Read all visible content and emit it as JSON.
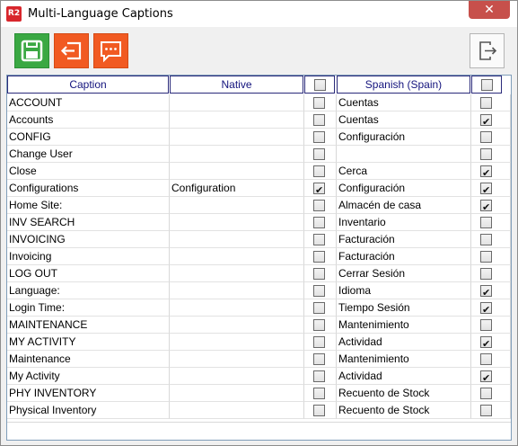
{
  "window": {
    "title": "Multi-Language Captions",
    "icon_text": "R2",
    "close_glyph": "✕"
  },
  "toolbar": {
    "buttons": [
      {
        "name": "save-button",
        "icon": "floppy-disk-icon",
        "color": "#3aa843"
      },
      {
        "name": "export-button",
        "icon": "export-icon",
        "color": "#f15a22"
      },
      {
        "name": "message-button",
        "icon": "chat-bubble-icon",
        "color": "#f15a22"
      },
      {
        "name": "exit-button",
        "icon": "exit-door-icon",
        "color": "#fafafa"
      }
    ]
  },
  "grid": {
    "headers": {
      "caption": "Caption",
      "native": "Native",
      "native_all_checked": false,
      "language": "Spanish (Spain)",
      "language_all_checked": false
    },
    "rows": [
      {
        "caption": "ACCOUNT",
        "native": "",
        "native_checked": false,
        "translation": "Cuentas",
        "translation_checked": false
      },
      {
        "caption": "Accounts",
        "native": "",
        "native_checked": false,
        "translation": "Cuentas",
        "translation_checked": true
      },
      {
        "caption": "CONFIG",
        "native": "",
        "native_checked": false,
        "translation": "Configuración",
        "translation_checked": false
      },
      {
        "caption": "Change User",
        "native": "",
        "native_checked": false,
        "translation": "",
        "translation_checked": false
      },
      {
        "caption": "Close",
        "native": "",
        "native_checked": false,
        "translation": "Cerca",
        "translation_checked": true
      },
      {
        "caption": "Configurations",
        "native": "Configuration",
        "native_checked": true,
        "translation": "Configuración",
        "translation_checked": true
      },
      {
        "caption": "Home Site:",
        "native": "",
        "native_checked": false,
        "translation": "Almacén de casa",
        "translation_checked": true
      },
      {
        "caption": "INV SEARCH",
        "native": "",
        "native_checked": false,
        "translation": "Inventario",
        "translation_checked": false
      },
      {
        "caption": "INVOICING",
        "native": "",
        "native_checked": false,
        "translation": "Facturación",
        "translation_checked": false
      },
      {
        "caption": "Invoicing",
        "native": "",
        "native_checked": false,
        "translation": "Facturación",
        "translation_checked": false
      },
      {
        "caption": "LOG OUT",
        "native": "",
        "native_checked": false,
        "translation": "Cerrar Sesión",
        "translation_checked": false
      },
      {
        "caption": "Language:",
        "native": "",
        "native_checked": false,
        "translation": "Idioma",
        "translation_checked": true
      },
      {
        "caption": "Login Time:",
        "native": "",
        "native_checked": false,
        "translation": "Tiempo Sesión",
        "translation_checked": true
      },
      {
        "caption": "MAINTENANCE",
        "native": "",
        "native_checked": false,
        "translation": "Mantenimiento",
        "translation_checked": false
      },
      {
        "caption": "MY ACTIVITY",
        "native": "",
        "native_checked": false,
        "translation": "Actividad",
        "translation_checked": true
      },
      {
        "caption": "Maintenance",
        "native": "",
        "native_checked": false,
        "translation": "Mantenimiento",
        "translation_checked": false
      },
      {
        "caption": "My Activity",
        "native": "",
        "native_checked": false,
        "translation": "Actividad",
        "translation_checked": true
      },
      {
        "caption": "PHY INVENTORY",
        "native": "",
        "native_checked": false,
        "translation": "Recuento de Stock",
        "translation_checked": false
      },
      {
        "caption": "Physical Inventory",
        "native": "",
        "native_checked": false,
        "translation": "Recuento de Stock",
        "translation_checked": false
      }
    ]
  }
}
